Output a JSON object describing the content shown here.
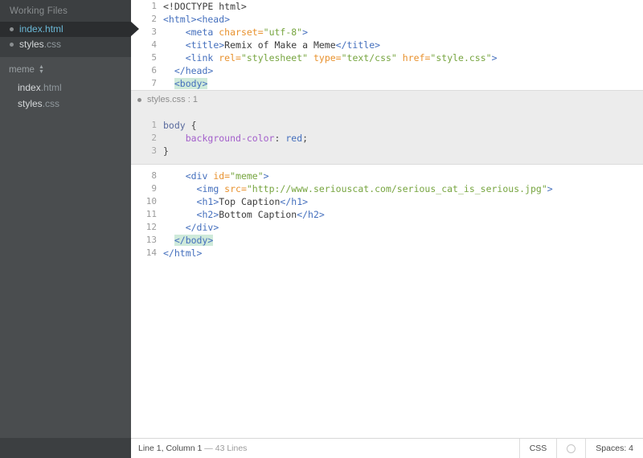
{
  "sidebar": {
    "working_files_title": "Working Files",
    "working_files": [
      {
        "name": "index",
        "ext": ".html",
        "selected": true
      },
      {
        "name": "styles",
        "ext": ".css",
        "selected": false
      }
    ],
    "project_name": "meme",
    "project_files": [
      {
        "name": "index",
        "ext": ".html"
      },
      {
        "name": "styles",
        "ext": ".css"
      }
    ]
  },
  "editor": {
    "top_lines": [
      {
        "num": "1",
        "tokens": [
          {
            "t": "<!DOCTYPE html>",
            "c": "t-doct"
          }
        ]
      },
      {
        "num": "2",
        "tokens": [
          {
            "t": "<html><head>",
            "c": "t-tag"
          }
        ]
      },
      {
        "num": "3",
        "tokens": [
          {
            "t": "    ",
            "c": "t-txt"
          },
          {
            "t": "<meta ",
            "c": "t-tag"
          },
          {
            "t": "charset=",
            "c": "t-attr"
          },
          {
            "t": "\"utf-8\"",
            "c": "t-str"
          },
          {
            "t": ">",
            "c": "t-tag"
          }
        ]
      },
      {
        "num": "4",
        "tokens": [
          {
            "t": "    ",
            "c": "t-txt"
          },
          {
            "t": "<title>",
            "c": "t-tag"
          },
          {
            "t": "Remix of Make a Meme",
            "c": "t-txt"
          },
          {
            "t": "</title>",
            "c": "t-tag"
          }
        ]
      },
      {
        "num": "5",
        "tokens": [
          {
            "t": "    ",
            "c": "t-txt"
          },
          {
            "t": "<link ",
            "c": "t-tag"
          },
          {
            "t": "rel=",
            "c": "t-attr"
          },
          {
            "t": "\"stylesheet\"",
            "c": "t-str"
          },
          {
            "t": " ",
            "c": "t-txt"
          },
          {
            "t": "type=",
            "c": "t-attr"
          },
          {
            "t": "\"text/css\"",
            "c": "t-str"
          },
          {
            "t": " ",
            "c": "t-txt"
          },
          {
            "t": "href=",
            "c": "t-attr"
          },
          {
            "t": "\"style.css\"",
            "c": "t-str"
          },
          {
            "t": ">",
            "c": "t-tag"
          }
        ]
      },
      {
        "num": "6",
        "tokens": [
          {
            "t": "  ",
            "c": "t-txt"
          },
          {
            "t": "</head>",
            "c": "t-tag"
          }
        ]
      },
      {
        "num": "7",
        "tokens": [
          {
            "t": "  ",
            "c": "t-txt"
          },
          {
            "t": "<body>",
            "c": "t-tag hl"
          }
        ]
      }
    ],
    "inline_widget": {
      "title": "styles.css : 1",
      "lines": [
        {
          "num": "1",
          "tokens": [
            {
              "t": "body ",
              "c": "c-sel"
            },
            {
              "t": "{",
              "c": "c-punc"
            }
          ]
        },
        {
          "num": "2",
          "tokens": [
            {
              "t": "    ",
              "c": "c-punc"
            },
            {
              "t": "background-color",
              "c": "c-prop"
            },
            {
              "t": ": ",
              "c": "c-punc"
            },
            {
              "t": "red",
              "c": "c-val"
            },
            {
              "t": ";",
              "c": "c-punc"
            }
          ]
        },
        {
          "num": "3",
          "tokens": [
            {
              "t": "}",
              "c": "c-punc"
            }
          ]
        }
      ]
    },
    "bottom_lines": [
      {
        "num": "8",
        "tokens": [
          {
            "t": "    ",
            "c": "t-txt"
          },
          {
            "t": "<div ",
            "c": "t-tag"
          },
          {
            "t": "id=",
            "c": "t-attr"
          },
          {
            "t": "\"meme\"",
            "c": "t-str"
          },
          {
            "t": ">",
            "c": "t-tag"
          }
        ]
      },
      {
        "num": "9",
        "tokens": [
          {
            "t": "      ",
            "c": "t-txt"
          },
          {
            "t": "<img ",
            "c": "t-tag"
          },
          {
            "t": "src=",
            "c": "t-attr"
          },
          {
            "t": "\"http://www.seriouscat.com/serious_cat_is_serious.jpg\"",
            "c": "t-str"
          },
          {
            "t": ">",
            "c": "t-tag"
          }
        ]
      },
      {
        "num": "10",
        "tokens": [
          {
            "t": "      ",
            "c": "t-txt"
          },
          {
            "t": "<h1>",
            "c": "t-tag"
          },
          {
            "t": "Top Caption",
            "c": "t-txt"
          },
          {
            "t": "</h1>",
            "c": "t-tag"
          }
        ]
      },
      {
        "num": "11",
        "tokens": [
          {
            "t": "      ",
            "c": "t-txt"
          },
          {
            "t": "<h2>",
            "c": "t-tag"
          },
          {
            "t": "Bottom Caption",
            "c": "t-txt"
          },
          {
            "t": "</h2>",
            "c": "t-tag"
          }
        ]
      },
      {
        "num": "12",
        "tokens": [
          {
            "t": "    ",
            "c": "t-txt"
          },
          {
            "t": "</div>",
            "c": "t-tag"
          }
        ]
      },
      {
        "num": "13",
        "tokens": [
          {
            "t": "  ",
            "c": "t-txt"
          },
          {
            "t": "</body>",
            "c": "t-tag hl"
          }
        ]
      },
      {
        "num": "14",
        "tokens": [
          {
            "t": "</html>",
            "c": "t-tag"
          }
        ]
      }
    ]
  },
  "statusbar": {
    "cursor_info": "Line 1, Column 1",
    "separator": " — ",
    "line_count": "43 Lines",
    "language": "CSS",
    "lint_icon": "circle-icon",
    "indent": "Spaces: 4"
  },
  "colors": {
    "sidebar_bg": "#3c3f41",
    "project_bg": "#4a4d4f",
    "selection_bg": "#2b2d2f",
    "selection_fg": "#6bb8d6",
    "tag": "#446fbd",
    "attr": "#e8912d",
    "string": "#77a540",
    "highlight": "#cfeada",
    "css_prop": "#a35fcb",
    "inline_bg": "#ececec"
  }
}
